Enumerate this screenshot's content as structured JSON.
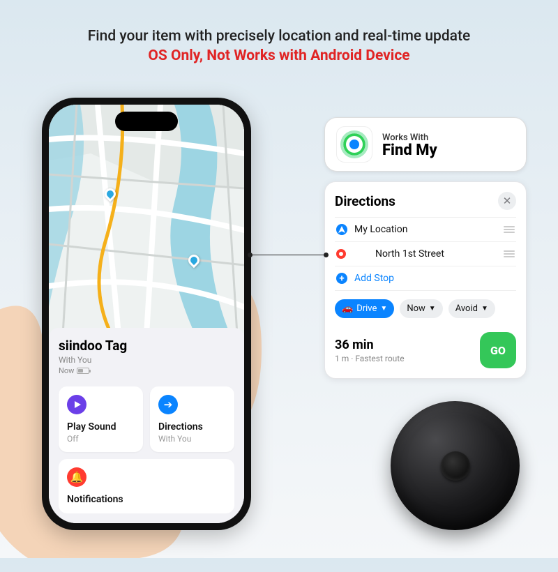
{
  "headline": {
    "line1": "Find your item with precisely location and real-time update",
    "line2": "OS Only, Not Works with Android Device"
  },
  "phone": {
    "item_name": "siindoo Tag",
    "with_you": "With You",
    "now": "Now",
    "tiles": {
      "play_sound": {
        "title": "Play Sound",
        "sub": "Off"
      },
      "directions": {
        "title": "Directions",
        "sub": "With You"
      },
      "notifications": {
        "title": "Notifications"
      }
    }
  },
  "works_with": {
    "small": "Works With",
    "title": "Find My"
  },
  "directions_card": {
    "title": "Directions",
    "my_location": "My Location",
    "destination": "North 1st Street",
    "add_stop": "Add Stop",
    "mode": "Drive",
    "now": "Now",
    "avoid": "Avoid",
    "eta_time": "36 min",
    "eta_sub": "1 m · Fastest route",
    "go": "GO"
  }
}
